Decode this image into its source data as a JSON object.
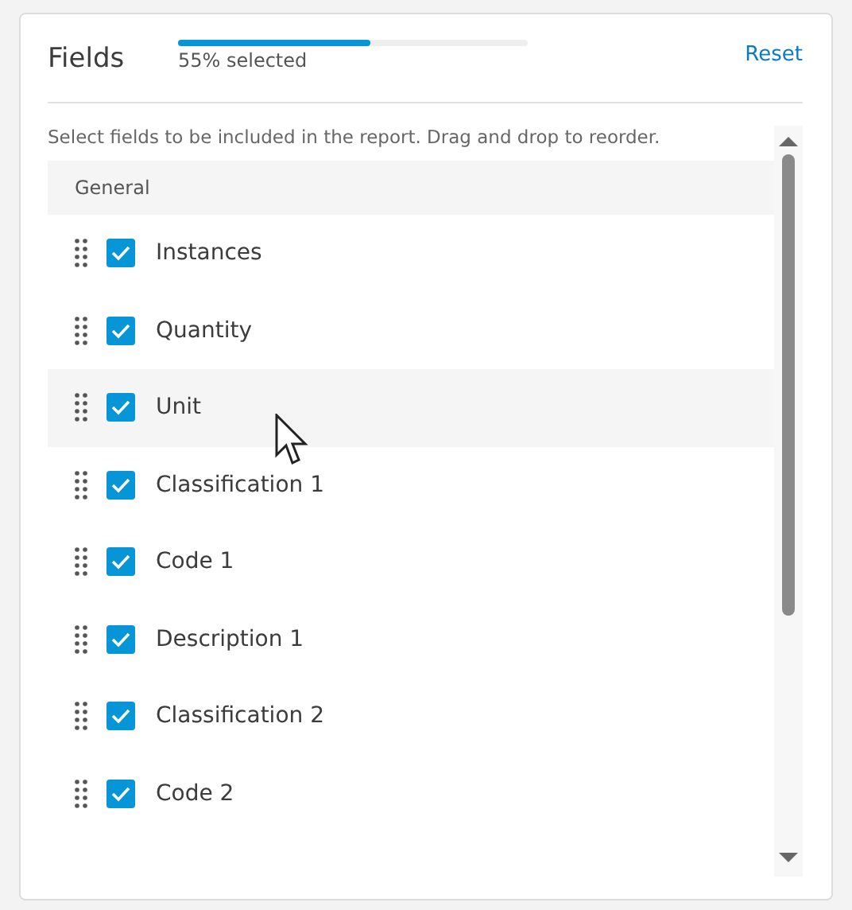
{
  "panel": {
    "title": "Fields",
    "progress": {
      "level": 0.55,
      "label": "55% selected"
    },
    "reset_link": "Reset"
  },
  "description": "Select fields to be included in the report. Drag and drop to reorder.",
  "groups": [
    {
      "label": "General",
      "fields": [
        {
          "label": "Instances",
          "checked": true,
          "hovered": false
        },
        {
          "label": "Quantity",
          "checked": true,
          "hovered": false
        },
        {
          "label": "Unit",
          "checked": true,
          "hovered": true
        },
        {
          "label": "Classification 1",
          "checked": true,
          "hovered": false
        },
        {
          "label": "Code 1",
          "checked": true,
          "hovered": false
        },
        {
          "label": "Description 1",
          "checked": true,
          "hovered": false
        },
        {
          "label": "Classification 2",
          "checked": true,
          "hovered": false
        },
        {
          "label": "Code 2",
          "checked": true,
          "hovered": false
        }
      ]
    }
  ]
}
